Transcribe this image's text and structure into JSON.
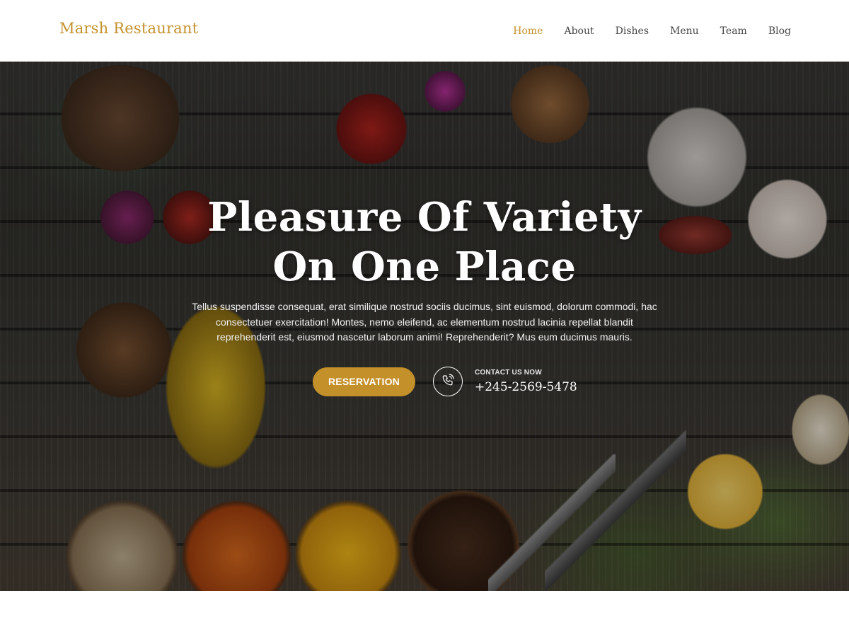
{
  "header": {
    "logo": "Marsh Restaurant",
    "nav": [
      {
        "label": "Home",
        "active": true
      },
      {
        "label": "About",
        "active": false
      },
      {
        "label": "Dishes",
        "active": false
      },
      {
        "label": "Menu",
        "active": false
      },
      {
        "label": "Team",
        "active": false
      },
      {
        "label": "Blog",
        "active": false
      }
    ]
  },
  "hero": {
    "title_line1": "Pleasure Of Variety",
    "title_line2": "On One Place",
    "description": "Tellus suspendisse consequat, erat similique nostrud sociis ducimus, sint euismod, dolorum commodi, hac consectetuer exercitation! Montes, nemo eleifend, ac elementum nostrud lacinia repellat blandit reprehenderit est, eiusmod nascetur laborum animi! Reprehenderit? Mus eum ducimus mauris.",
    "reservation_label": "RESERVATION",
    "contact_label": "CONTACT US NOW",
    "contact_number": "+245-2569-5478",
    "phone_icon": "phone-icon"
  },
  "colors": {
    "accent": "#c4902a",
    "nav_text": "#444444",
    "hero_text": "#ffffff"
  }
}
